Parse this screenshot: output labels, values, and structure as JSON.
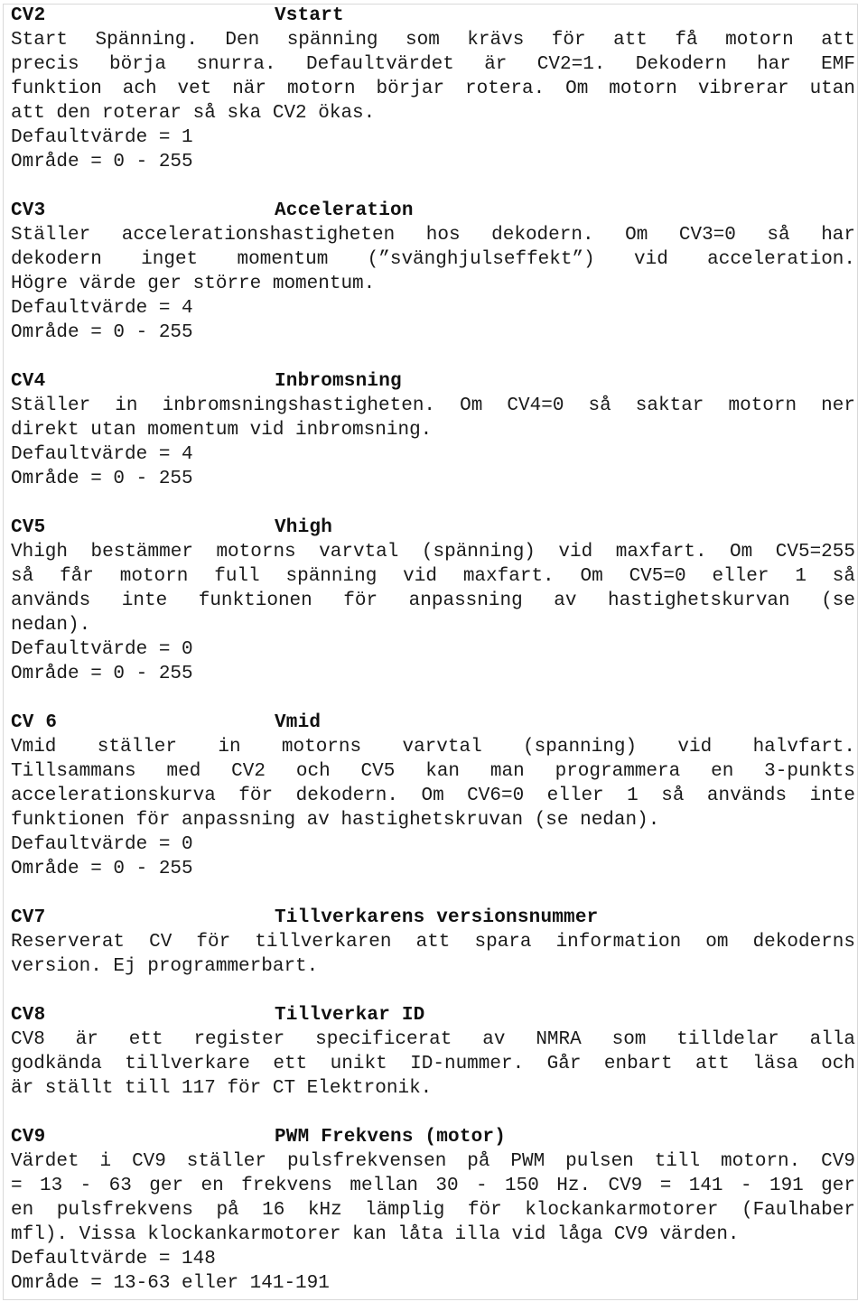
{
  "document": {
    "type": "scanned-manual-page",
    "language": "sv",
    "sections": [
      {
        "id": "CV2",
        "title": "Vstart",
        "lines": [
          "Start Spänning. Den spänning som krävs för att få motorn att",
          "precis börja snurra. Defaultvärdet är CV2=1. Dekodern har EMF",
          "funktion ach vet när motorn börjar rotera. Om motorn vibrerar utan",
          "att den roterar så ska CV2 ökas."
        ],
        "default_label": "Defaultvärde = 1",
        "range_label": "Område = 0 - 255"
      },
      {
        "id": "CV3",
        "title": "Acceleration",
        "lines": [
          "Ställer accelerationshastigheten hos dekodern. Om CV3=0 så har",
          "dekodern inget momentum (”svänghjulseffekt”) vid acceleration.",
          "Högre värde ger större momentum."
        ],
        "default_label": "Defaultvärde = 4",
        "range_label": "Område = 0 - 255"
      },
      {
        "id": "CV4",
        "title": "Inbromsning",
        "lines": [
          "Ställer in inbromsningshastigheten. Om CV4=0 så saktar motorn ner",
          "direkt utan momentum vid inbromsning."
        ],
        "default_label": "Defaultvärde = 4",
        "range_label": "Område = 0 - 255"
      },
      {
        "id": "CV5",
        "title": "Vhigh",
        "lines": [
          "Vhigh bestämmer motorns varvtal (spänning) vid maxfart. Om CV5=255",
          "så får motorn full spänning vid maxfart. Om CV5=0 eller 1 så",
          "används inte funktionen för anpassning av hastighetskurvan (se",
          "nedan)."
        ],
        "default_label": "Defaultvärde = 0",
        "range_label": "Område = 0 - 255"
      },
      {
        "id": "CV 6",
        "title": "Vmid",
        "lines": [
          "Vmid ställer in motorns varvtal (spanning) vid halvfart.",
          "Tillsammans med CV2 och CV5 kan man programmera en 3-punkts",
          "accelerationskurva för dekodern. Om CV6=0 eller 1 så används inte",
          "funktionen för anpassning av hastighetskruvan (se nedan)."
        ],
        "default_label": "Defaultvärde = 0",
        "range_label": "Område = 0 - 255"
      },
      {
        "id": "CV7",
        "title": "Tillverkarens versionsnummer",
        "lines": [
          "Reserverat CV för tillverkaren att spara information om dekoderns",
          "version. Ej programmerbart."
        ],
        "default_label": "",
        "range_label": ""
      },
      {
        "id": "CV8",
        "title": "Tillverkar ID",
        "lines": [
          "CV8 är ett register specificerat av NMRA som tilldelar alla",
          "godkända tillverkare ett unikt ID-nummer. Går enbart att läsa och",
          "är ställt till 117 för CT Elektronik."
        ],
        "default_label": "",
        "range_label": ""
      },
      {
        "id": "CV9",
        "title": "PWM Frekvens (motor)",
        "lines": [
          "Värdet i CV9 ställer pulsfrekvensen på PWM pulsen till motorn. CV9",
          "= 13 - 63 ger en frekvens mellan 30 - 150 Hz. CV9 = 141 - 191 ger",
          "en pulsfrekvens på 16 kHz lämplig för klockankarmotorer (Faulhaber",
          "mfl). Vissa klockankarmotorer kan låta illa vid låga CV9 värden."
        ],
        "default_label": "Defaultvärde = 148",
        "range_label": "Område = 13-63 eller 141-191"
      }
    ]
  }
}
